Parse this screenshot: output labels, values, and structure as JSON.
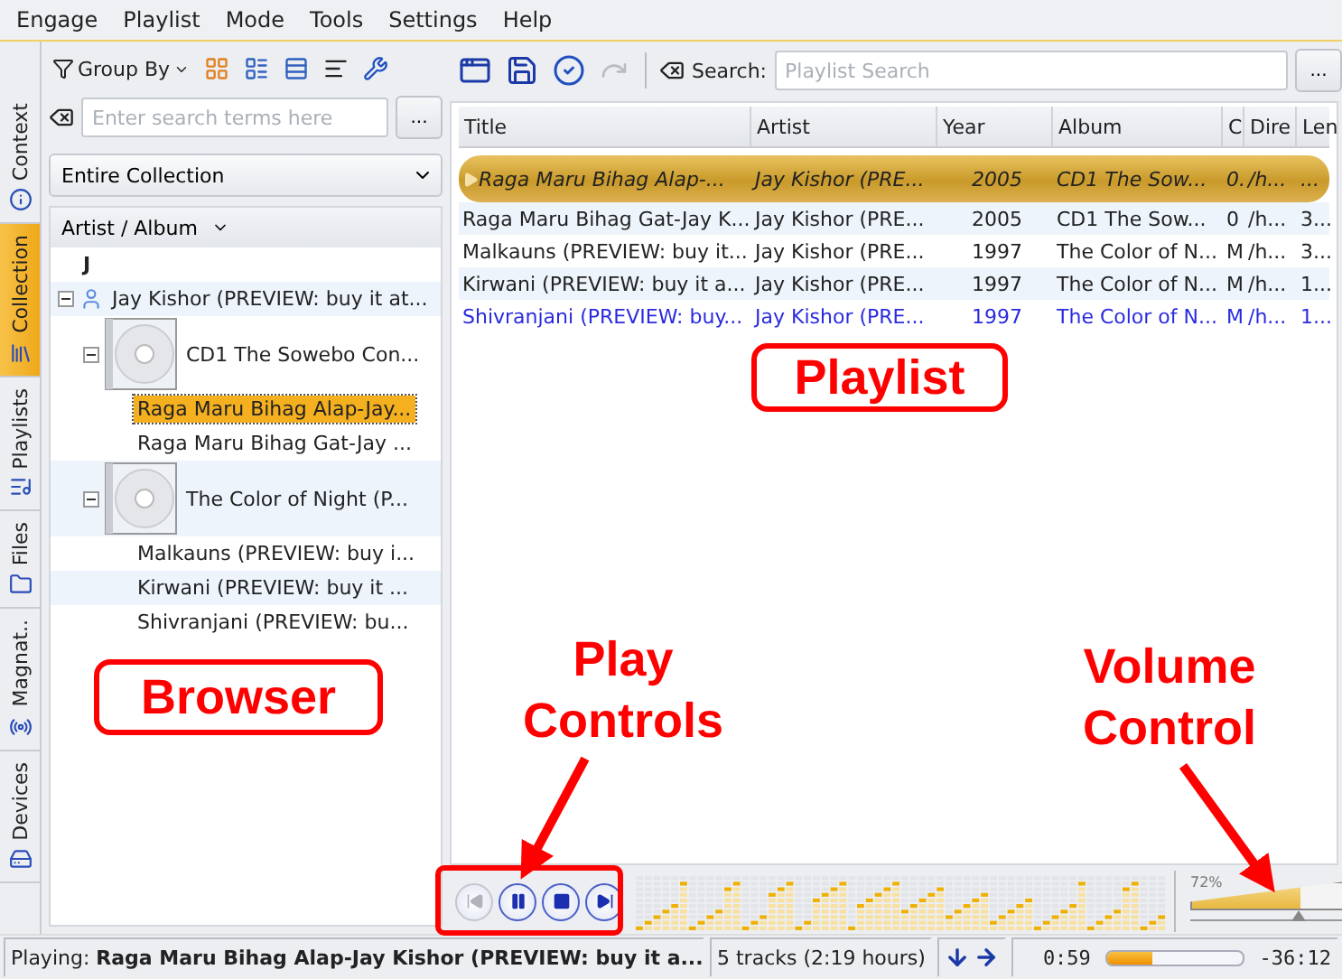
{
  "menu": [
    "Engage",
    "Playlist",
    "Mode",
    "Tools",
    "Settings",
    "Help"
  ],
  "side_tabs": [
    {
      "label": "Context",
      "kind": "info",
      "selected": false
    },
    {
      "label": "Collection",
      "kind": "library",
      "selected": true
    },
    {
      "label": "Playlists",
      "kind": "playlists",
      "selected": false
    },
    {
      "label": "Files",
      "kind": "files",
      "selected": false
    },
    {
      "label": "Magnat..",
      "kind": "radio",
      "selected": false
    },
    {
      "label": "Devices",
      "kind": "devices",
      "selected": false
    }
  ],
  "browser": {
    "group_by": "Group By",
    "search": {
      "placeholder": "Enter search terms here"
    },
    "more_button": "...",
    "filter": "Entire Collection",
    "header": "Artist / Album",
    "tree": [
      {
        "label": "J",
        "kind": "letter"
      },
      {
        "label": "Jay Kishor (PREVIEW: buy it at...",
        "kind": "artist",
        "expanded": true,
        "children": [
          {
            "label": "CD1 The Sowebo Con...",
            "kind": "album",
            "expanded": true,
            "children": [
              {
                "label": "Raga Maru Bihag Alap-Jay...",
                "kind": "track",
                "selected": true
              },
              {
                "label": "Raga Maru Bihag Gat-Jay ...",
                "kind": "track",
                "selected": false
              }
            ]
          },
          {
            "label": "The Color of Night (P...",
            "kind": "album",
            "expanded": true,
            "children": [
              {
                "label": "Malkauns (PREVIEW: buy i...",
                "kind": "track",
                "selected": false
              },
              {
                "label": "Kirwani (PREVIEW: buy it ...",
                "kind": "track",
                "selected": false
              },
              {
                "label": "Shivranjani (PREVIEW: bu...",
                "kind": "track",
                "selected": false
              }
            ]
          }
        ]
      }
    ]
  },
  "playlist": {
    "search_label": "Search:",
    "search": {
      "placeholder": "Playlist Search"
    },
    "more_button": "...",
    "columns": [
      "Title",
      "Artist",
      "Year",
      "Album",
      "C",
      "Dire",
      "Len"
    ],
    "rows": [
      {
        "cells": [
          "Raga Maru Bihag Alap-...",
          "Jay Kishor (PRE...",
          "2005",
          "CD1 The Sow...",
          "0.",
          "/h...",
          "..."
        ],
        "playing": true,
        "selected": false
      },
      {
        "cells": [
          "Raga Maru Bihag Gat-Jay K...",
          "Jay Kishor (PRE...",
          "2005",
          "CD1 The Sow...",
          "0",
          "/h...",
          "3..."
        ],
        "playing": false,
        "selected": false
      },
      {
        "cells": [
          "Malkauns (PREVIEW: buy it...",
          "Jay Kishor (PRE...",
          "1997",
          "The Color of N...",
          "M",
          "/h...",
          "3..."
        ],
        "playing": false,
        "selected": false
      },
      {
        "cells": [
          "Kirwani (PREVIEW: buy it a...",
          "Jay Kishor (PRE...",
          "1997",
          "The Color of N...",
          "M",
          "/h...",
          "1..."
        ],
        "playing": false,
        "selected": false
      },
      {
        "cells": [
          "Shivranjani (PREVIEW: buy...",
          "Jay Kishor (PRE...",
          "1997",
          "The Color of N...",
          "M",
          "/h...",
          "1..."
        ],
        "playing": false,
        "selected": true
      }
    ]
  },
  "controls": [
    {
      "kind": "previous",
      "disabled": true
    },
    {
      "kind": "pause",
      "disabled": false
    },
    {
      "kind": "stop",
      "disabled": false
    },
    {
      "kind": "next",
      "disabled": false
    }
  ],
  "volume": {
    "reading": "72%",
    "level": 0.72
  },
  "status_bar": {
    "now_playing": "Playing: **Raga Maru Bihag Alap-Jay Kishor (PREVIEW: buy it a...**",
    "tracks": "5 tracks (2:19 hours)",
    "elapsed": "0:59",
    "remaining": "-36:12",
    "level": 0.33
  },
  "annotations": [
    {
      "text": "Playlist",
      "kind": "boxed"
    },
    {
      "text": "Browser",
      "kind": "boxed"
    },
    {
      "text": "Play Controls",
      "kind": "arrow"
    },
    {
      "text": "Volume Control",
      "kind": "arrow"
    }
  ]
}
